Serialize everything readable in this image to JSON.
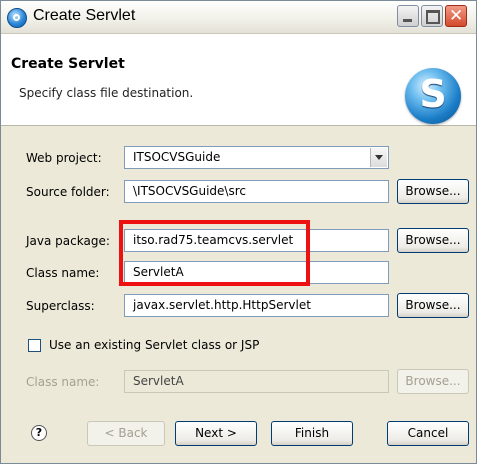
{
  "window": {
    "title": "Create Servlet"
  },
  "header": {
    "title": "Create Servlet",
    "subtitle": "Specify class file destination."
  },
  "form": {
    "web_project_label": "Web project:",
    "web_project_value": "ITSOCVSGuide",
    "source_folder_label": "Source folder:",
    "source_folder_value": "\\ITSOCVSGuide\\src",
    "java_package_label": "Java package:",
    "java_package_value": "itso.rad75.teamcvs.servlet",
    "class_name_label": "Class name:",
    "class_name_value": "ServletA",
    "superclass_label": "Superclass:",
    "superclass_value": "javax.servlet.http.HttpServlet",
    "use_existing_label": "Use an existing Servlet class or JSP",
    "use_existing_checked": false,
    "existing_class_label": "Class name:",
    "existing_class_value": "ServletA",
    "browse_label": "Browse..."
  },
  "footer": {
    "help_label": "?",
    "back_label": "< Back",
    "next_label": "Next >",
    "finish_label": "Finish",
    "cancel_label": "Cancel"
  },
  "colors": {
    "highlight": "#ee1111",
    "dialog_bg": "#ece9d8"
  }
}
